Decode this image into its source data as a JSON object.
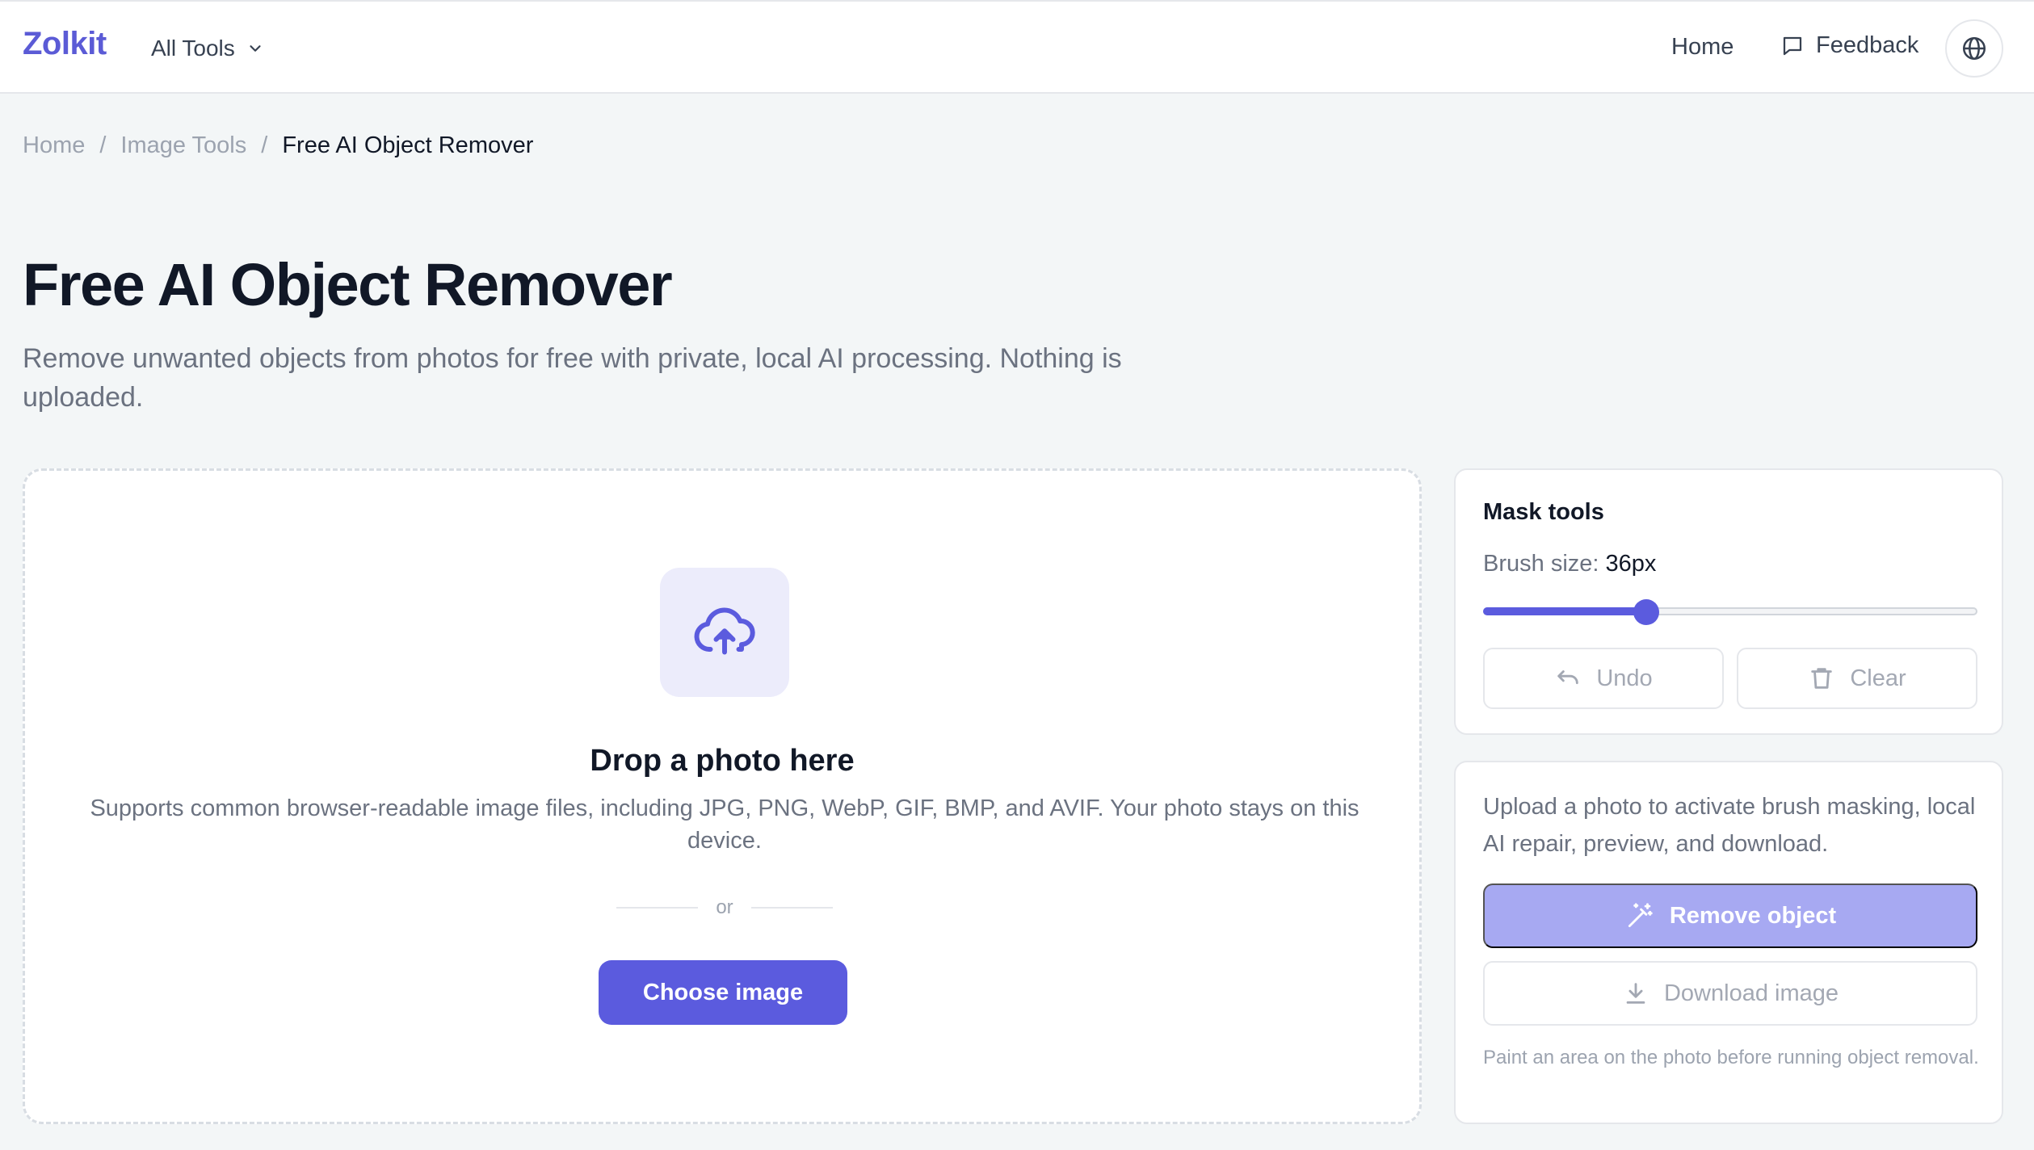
{
  "header": {
    "logo": "Zolkit",
    "all_tools_label": "All Tools",
    "nav": {
      "home_label": "Home",
      "feedback_label": "Feedback"
    },
    "icons": [
      "chevron-down-icon",
      "chat-icon",
      "globe-icon"
    ]
  },
  "breadcrumb": {
    "items": [
      "Home",
      "Image Tools",
      "Free AI Object Remover"
    ],
    "separator": "/"
  },
  "page": {
    "title": "Free AI Object Remover",
    "subtitle": "Remove unwanted objects from photos for free with private, local AI processing. Nothing is uploaded."
  },
  "dropzone": {
    "icon": "cloud-upload-icon",
    "title": "Drop a photo here",
    "description": "Supports common browser-readable image files, including JPG, PNG, WebP, GIF, BMP, and AVIF. Your photo stays on this device.",
    "or_label": "or",
    "choose_label": "Choose image"
  },
  "mask_tools": {
    "title": "Mask tools",
    "brush_label": "Brush size:",
    "brush_value": "36px",
    "brush_fraction": 0.33,
    "undo_label": "Undo",
    "clear_label": "Clear"
  },
  "actions": {
    "message": "Upload a photo to activate brush masking, local AI repair, preview, and download.",
    "remove_label": "Remove object",
    "download_label": "Download image",
    "hint": "Paint an area on the photo before running object removal."
  },
  "colors": {
    "accent": "#5b5bde",
    "accent_disabled": "#a7a9f2",
    "background": "#f3f6f7"
  }
}
